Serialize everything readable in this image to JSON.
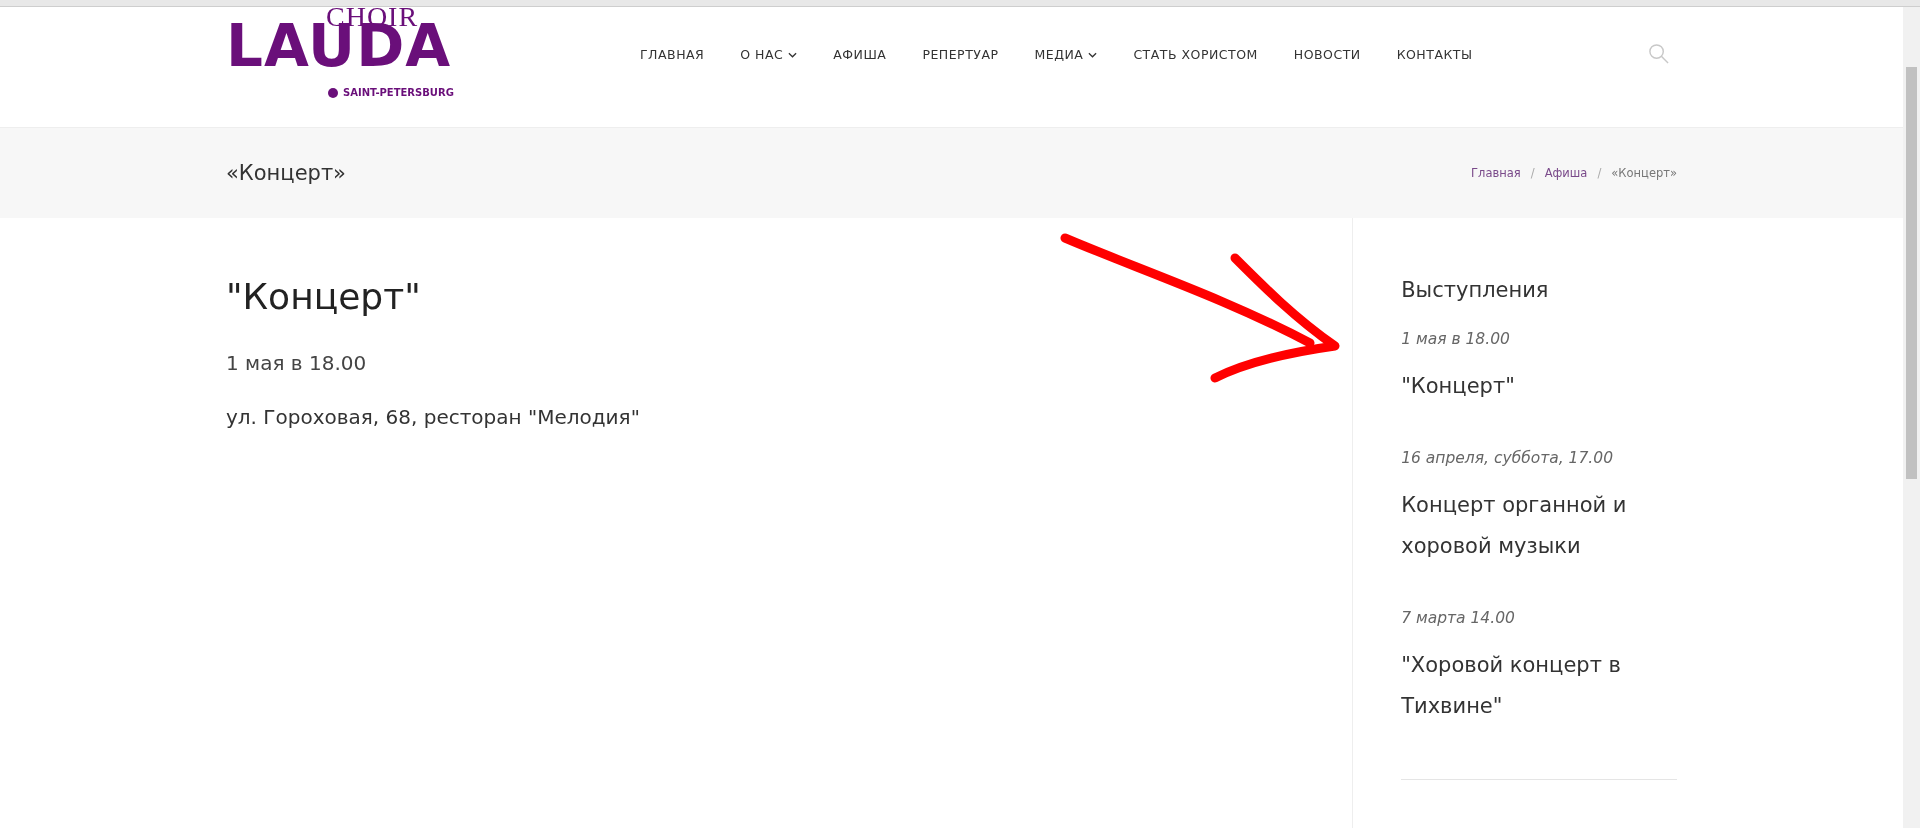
{
  "logo": {
    "name": "LAUDA",
    "subtitle": "CHOIR",
    "city": "SAINT-PETERSBURG"
  },
  "nav": [
    {
      "label": "ГЛАВНАЯ",
      "dropdown": false
    },
    {
      "label": "О НАС",
      "dropdown": true
    },
    {
      "label": "АФИША",
      "dropdown": false
    },
    {
      "label": "РЕПЕРТУАР",
      "dropdown": false
    },
    {
      "label": "МЕДИА",
      "dropdown": true
    },
    {
      "label": "СТАТЬ ХОРИСТОМ",
      "dropdown": false
    },
    {
      "label": "НОВОСТИ",
      "dropdown": false
    },
    {
      "label": "КОНТАКТЫ",
      "dropdown": false
    }
  ],
  "page_title": "«Концерт»",
  "breadcrumbs": [
    {
      "label": "Главная",
      "link": true
    },
    {
      "label": "Афиша",
      "link": true
    },
    {
      "label": "«Концерт»",
      "link": false
    }
  ],
  "breadcrumb_separator": "/",
  "event": {
    "title": "\"Концерт\"",
    "date": "1 мая в 18.00",
    "address": "ул. Гороховая, 68, ресторан \"Мелодия\""
  },
  "sidebar": {
    "heading": "Выступления",
    "items": [
      {
        "date": "1 мая в 18.00",
        "title": "\"Концерт\""
      },
      {
        "date": "16 апреля, суббота, 17.00",
        "title": "Концерт органной и хоровой музыки"
      },
      {
        "date": "7 марта 14.00",
        "title": "\"Хоровой концерт в Тихвине\""
      }
    ]
  }
}
